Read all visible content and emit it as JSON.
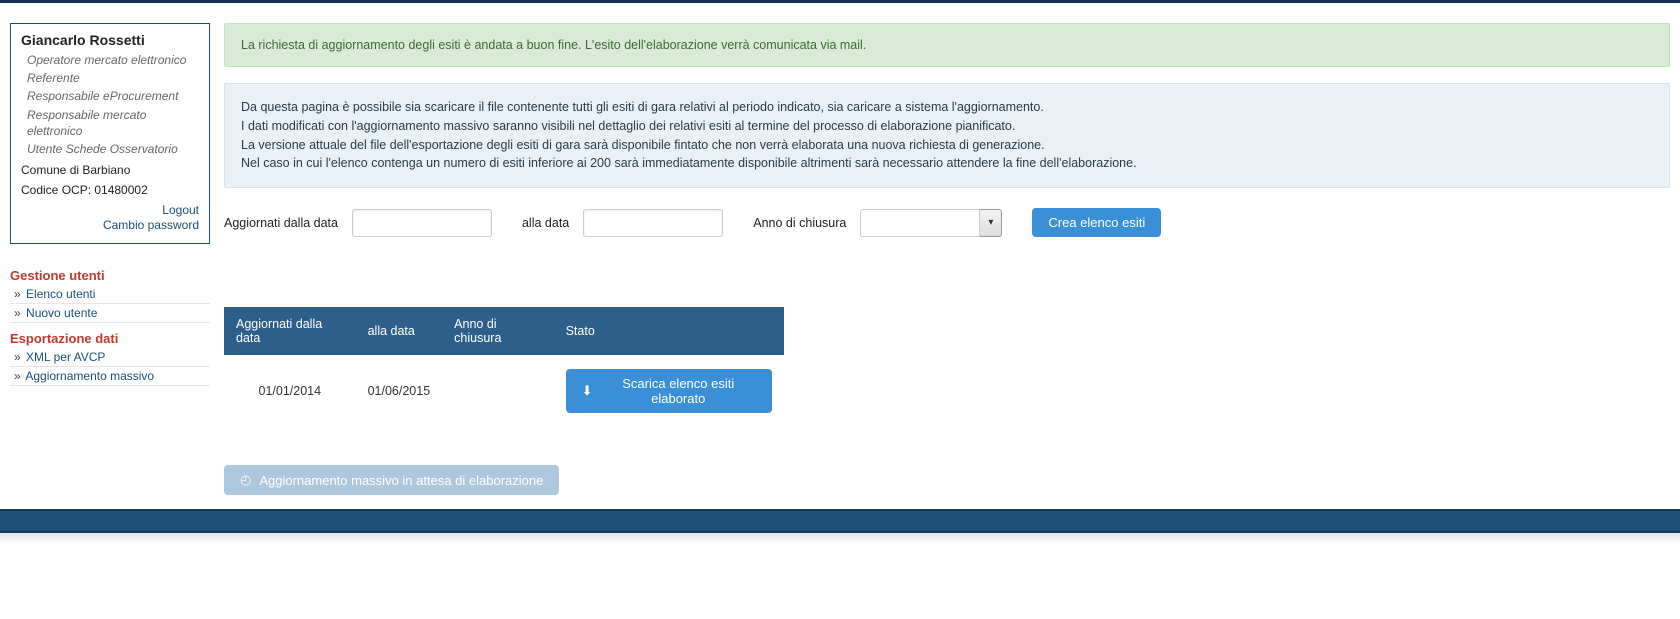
{
  "user": {
    "name": "Giancarlo Rossetti",
    "roles": [
      "Operatore mercato elettronico",
      "Referente",
      "Responsabile eProcurement",
      "Responsabile mercato elettronico",
      "Utente Schede Osservatorio"
    ],
    "org_name": "Comune di Barbiano",
    "org_code": "Codice OCP: 01480002",
    "logout_label": "Logout",
    "change_pw_label": "Cambio password"
  },
  "nav": {
    "sections": [
      {
        "title": "Gestione utenti",
        "items": [
          {
            "label": "Elenco utenti"
          },
          {
            "label": "Nuovo utente"
          }
        ]
      },
      {
        "title": "Esportazione dati",
        "items": [
          {
            "label": "XML per AVCP"
          },
          {
            "label": "Aggiornamento massivo"
          }
        ]
      }
    ]
  },
  "alert_success": "La richiesta di aggiornamento degli esiti è andata a buon fine. L'esito dell'elaborazione verrà comunicata via mail.",
  "info_lines": [
    "Da questa pagina è possibile sia scaricare il file contenente tutti gli esiti di gara relativi al periodo indicato, sia caricare a sistema l'aggiornamento.",
    "I dati modificati con l'aggiornamento massivo saranno visibili nel dettaglio dei relativi esiti al termine del processo di elaborazione pianificato.",
    "La versione attuale del file dell'esportazione degli esiti di gara sarà disponibile fintato che non verrà elaborata una nuova richiesta di generazione.",
    "Nel caso in cui l'elenco contenga un numero di esiti inferiore ai 200 sarà immediatamente disponibile altrimenti sarà necessario attendere la fine dell'elaborazione."
  ],
  "filters": {
    "from_label": "Aggiornati dalla data",
    "to_label": "alla data",
    "year_label": "Anno di chiusura",
    "submit_label": "Crea elenco esiti"
  },
  "table": {
    "headers": {
      "from": "Aggiornati dalla data",
      "to": "alla data",
      "year": "Anno di chiusura",
      "status": "Stato"
    },
    "row": {
      "from": "01/01/2014",
      "to": "01/06/2015",
      "year": "",
      "download_label": "Scarica elenco esiti elaborato"
    }
  },
  "bottom_button_label": "Aggiornamento massivo in attesa di elaborazione"
}
